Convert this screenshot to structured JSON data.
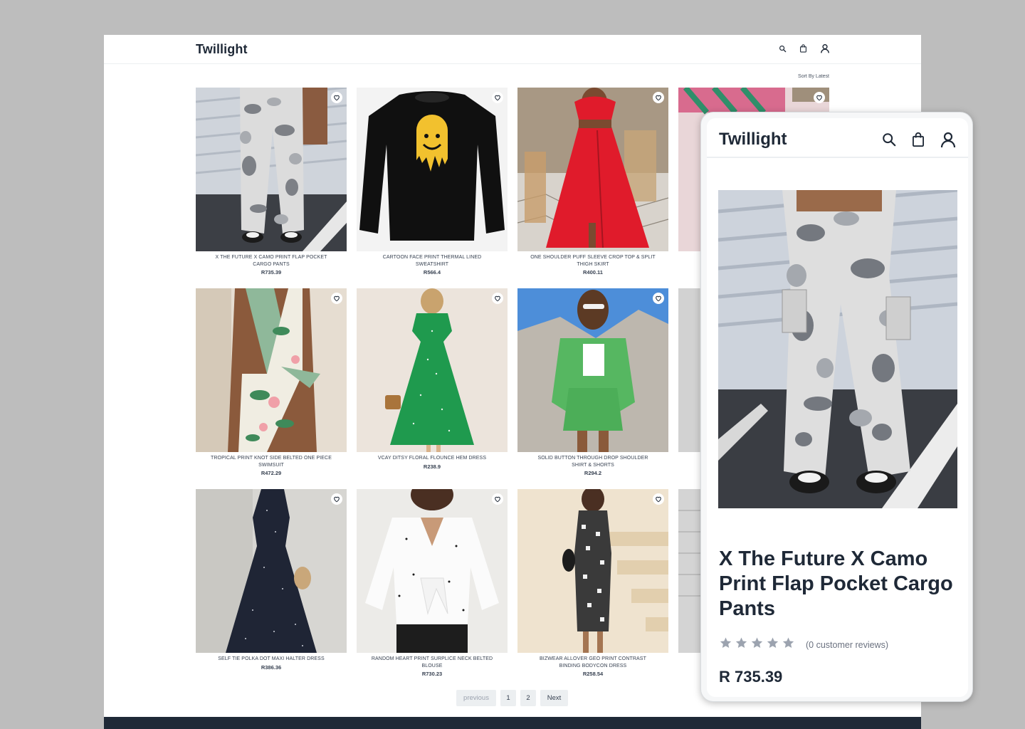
{
  "desktop": {
    "logo": "Twillight",
    "sort_label": "Sort By Latest",
    "header_icons": [
      "search-icon",
      "bag-icon",
      "user-icon"
    ],
    "products": [
      {
        "title": "X The Future X Camo Print Flap Pocket Cargo Pants",
        "price": "R735.39"
      },
      {
        "title": "Cartoon Face Print Thermal Lined Sweatshirt",
        "price": "R566.4"
      },
      {
        "title": "One Shoulder Puff Sleeve Crop Top & Split Thigh Skirt",
        "price": "R400.11"
      },
      {
        "title": "",
        "price": ""
      },
      {
        "title": "Tropical Print Knot Side Belted One Piece Swimsuit",
        "price": "R472.29"
      },
      {
        "title": "VCAY Ditsy Floral Flounce Hem Dress",
        "price": "R238.9"
      },
      {
        "title": "Solid Button Through Drop Shoulder Shirt & Shorts",
        "price": "R294.2"
      },
      {
        "title": "",
        "price": ""
      },
      {
        "title": "Self Tie Polka Dot Maxi Halter Dress",
        "price": "R386.36"
      },
      {
        "title": "Random Heart Print Surplice Neck Belted Blouse",
        "price": "R730.23"
      },
      {
        "title": "Bizwear Allover Geo Print Contrast Binding Bodycon Dress",
        "price": "R258.54"
      },
      {
        "title": "",
        "price": ""
      }
    ],
    "pagination": {
      "previous": "previous",
      "pages": [
        "1",
        "2"
      ],
      "next": "Next"
    }
  },
  "mobile": {
    "logo": "Twillight",
    "product_title": "X The Future X Camo Print Flap Pocket Cargo Pants",
    "rating": 0,
    "reviews": "(0 customer reviews)",
    "price": "R 735.39"
  },
  "colors": {
    "background": "#bdbdbd",
    "text_dark": "#1f2937",
    "footer": "#1f2937",
    "pager_bg": "#eceff1",
    "star_empty": "#9ca3af"
  }
}
